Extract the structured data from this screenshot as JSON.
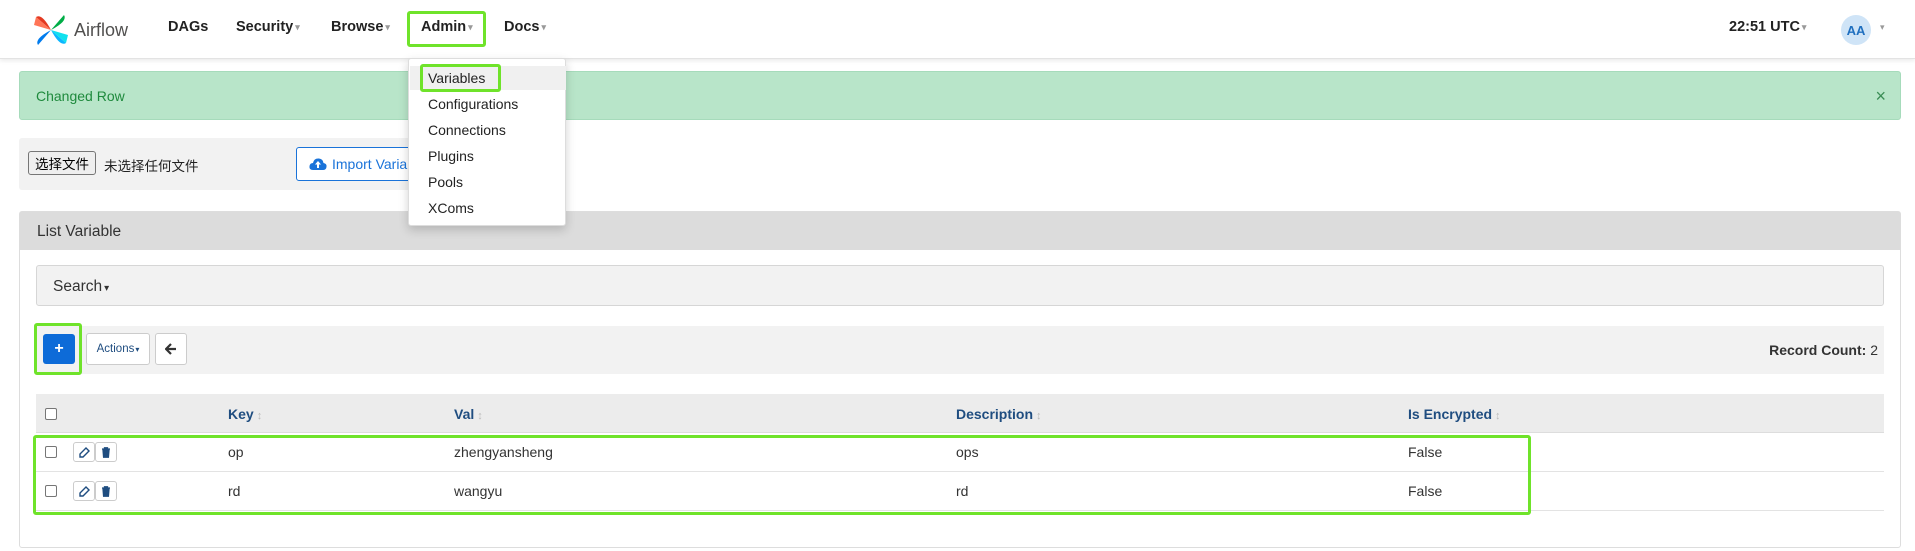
{
  "navbar": {
    "brand": "Airflow",
    "items": [
      {
        "label": "DAGs",
        "caret": false
      },
      {
        "label": "Security",
        "caret": true
      },
      {
        "label": "Browse",
        "caret": true
      },
      {
        "label": "Admin",
        "caret": true
      },
      {
        "label": "Docs",
        "caret": true
      }
    ],
    "time": "22:51 UTC",
    "avatar": "AA"
  },
  "admin_menu": {
    "items": [
      "Variables",
      "Configurations",
      "Connections",
      "Plugins",
      "Pools",
      "XComs"
    ],
    "active": "Variables"
  },
  "alert": {
    "message": "Changed Row",
    "close": "×"
  },
  "import": {
    "file_button": "选择文件",
    "file_status": "未选择任何文件",
    "import_button": "Import Variables"
  },
  "panel": {
    "title": "List Variable",
    "search_label": "Search",
    "actions_label": "Actions",
    "add_label": "+",
    "record_count_label": "Record Count:",
    "record_count": "2"
  },
  "table": {
    "columns": [
      "Key",
      "Val",
      "Description",
      "Is Encrypted"
    ],
    "rows": [
      {
        "key": "op",
        "val": "zhengyansheng",
        "description": "ops",
        "is_encrypted": "False"
      },
      {
        "key": "rd",
        "val": "wangyu",
        "description": "rd",
        "is_encrypted": "False"
      }
    ]
  },
  "colors": {
    "highlight": "#6fe32a",
    "primary": "#0d6bd8",
    "alert_bg": "#b8e5c9",
    "header_link": "#1f4d80"
  }
}
